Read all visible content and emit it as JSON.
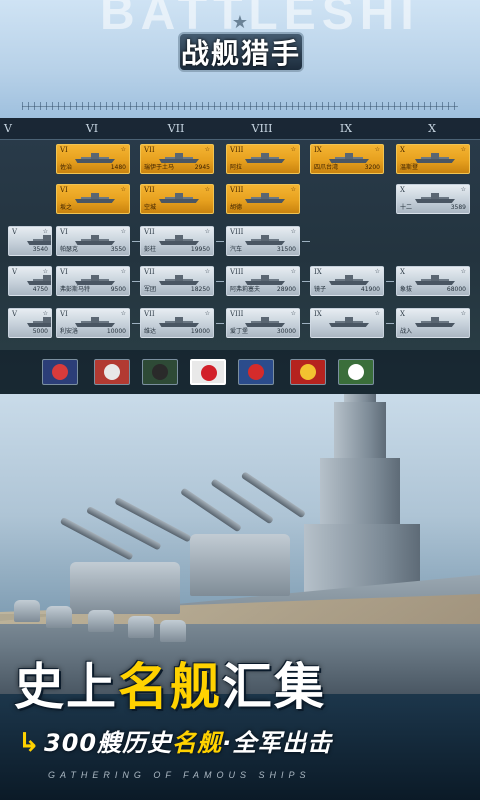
{
  "header": {
    "background_word": "BATTLESHI",
    "game_title": "战舰猎手"
  },
  "tiers": [
    "V",
    "VI",
    "VII",
    "VIII",
    "IX",
    "X"
  ],
  "tree_cards": [
    {
      "tier": "VI",
      "name": "佐治",
      "num": "1480",
      "gold": true
    },
    {
      "tier": "VII",
      "name": "瑞伊于土马",
      "num": "2945",
      "gold": true
    },
    {
      "tier": "VIII",
      "name": "阿拉",
      "num": "",
      "gold": true
    },
    {
      "tier": "IX",
      "name": "四爪台湾",
      "num": "3200",
      "gold": true
    },
    {
      "tier": "X",
      "name": "温斯登",
      "num": "",
      "gold": true
    },
    {
      "tier": "VI",
      "name": "坂之",
      "num": "",
      "gold": true
    },
    {
      "tier": "VII",
      "name": "空城",
      "num": "",
      "gold": true
    },
    {
      "tier": "VIII",
      "name": "胡德",
      "num": "",
      "gold": true
    },
    {
      "tier": "X",
      "name": "十二",
      "num": "3589",
      "gold": false
    },
    {
      "tier": "V",
      "name": "",
      "num": "3540",
      "gold": false
    },
    {
      "tier": "VI",
      "name": "帕瑟克",
      "num": "3550",
      "gold": false
    },
    {
      "tier": "VII",
      "name": "彭柱",
      "num": "19950",
      "gold": false
    },
    {
      "tier": "VIII",
      "name": "汽车",
      "num": "31500",
      "gold": false
    },
    {
      "tier": "V",
      "name": "",
      "num": "4750",
      "gold": false
    },
    {
      "tier": "VI",
      "name": "弗彭斯马特",
      "num": "9500",
      "gold": false
    },
    {
      "tier": "VII",
      "name": "军团",
      "num": "18250",
      "gold": false
    },
    {
      "tier": "VIII",
      "name": "阿弗莉塞夫",
      "num": "28900",
      "gold": false
    },
    {
      "tier": "IX",
      "name": "镜子",
      "num": "41900",
      "gold": false
    },
    {
      "tier": "X",
      "name": "象拔",
      "num": "68000",
      "gold": false
    },
    {
      "tier": "V",
      "name": "",
      "num": "5000",
      "gold": false
    },
    {
      "tier": "VI",
      "name": "利安洛",
      "num": "10000",
      "gold": false
    },
    {
      "tier": "VII",
      "name": "维达",
      "num": "19000",
      "gold": false
    },
    {
      "tier": "VIII",
      "name": "爱丁堡",
      "num": "30000",
      "gold": false
    },
    {
      "tier": "IX",
      "name": "",
      "num": "",
      "gold": false
    },
    {
      "tier": "X",
      "name": "战入",
      "num": "",
      "gold": false
    }
  ],
  "nations": [
    {
      "name": "usa-flag",
      "bg": "#2c3e78",
      "emb": "#d93b3b",
      "selected": false
    },
    {
      "name": "uk-flag",
      "bg": "#b23a32",
      "emb": "#e8e8e8",
      "selected": false
    },
    {
      "name": "germany-flag",
      "bg": "#2e4a36",
      "emb": "#2a2a2a",
      "selected": false
    },
    {
      "name": "japan-flag",
      "bg": "#e9e9e9",
      "emb": "#d2202a",
      "selected": true
    },
    {
      "name": "france-flag",
      "bg": "#2b4c8c",
      "emb": "#d52b2b",
      "selected": false
    },
    {
      "name": "ussr-flag",
      "bg": "#b5231f",
      "emb": "#f2c230",
      "selected": false
    },
    {
      "name": "italy-flag",
      "bg": "#3a6e3a",
      "emb": "#ffffff",
      "selected": false
    }
  ],
  "slogan": {
    "part1": "史上",
    "highlight": "名舰",
    "part2": "汇集"
  },
  "subtitle": {
    "part1": "300艘历史",
    "highlight": "名舰",
    "part2": "·全军出击"
  },
  "english_tagline": "GATHERING OF FAMOUS SHIPS",
  "colors": {
    "accent": "#ffd200",
    "gold_card": "#e7a11f"
  }
}
